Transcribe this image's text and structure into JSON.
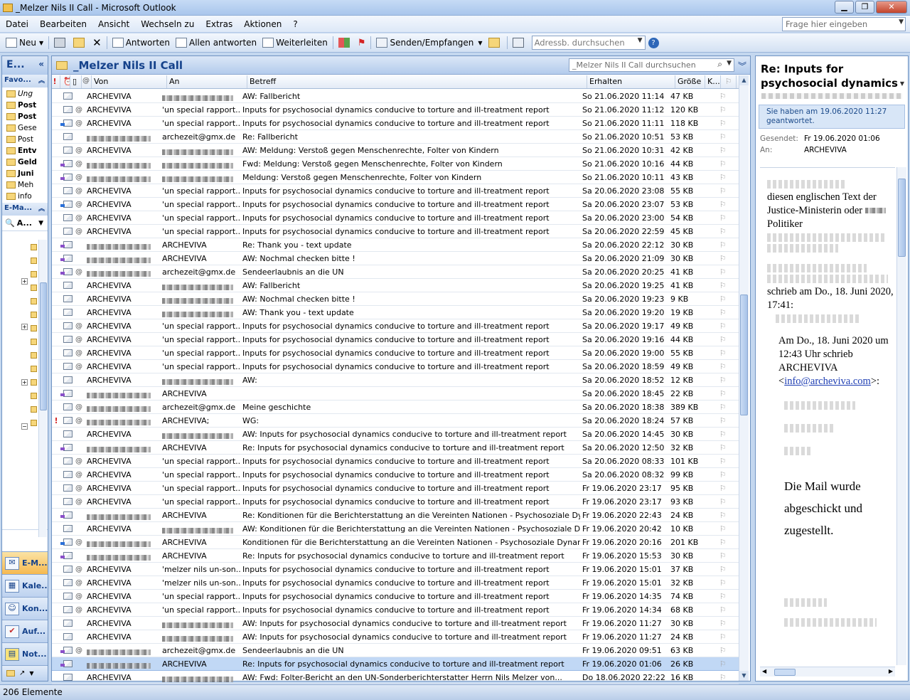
{
  "window": {
    "title": "_Melzer Nils II Call - Microsoft Outlook"
  },
  "menu": [
    "Datei",
    "Bearbeiten",
    "Ansicht",
    "Wechseln zu",
    "Extras",
    "Aktionen",
    "?"
  ],
  "help_placeholder": "Frage hier eingeben",
  "toolbar": {
    "new": "Neu",
    "reply": "Antworten",
    "reply_all": "Allen antworten",
    "forward": "Weiterleiten",
    "send_receive": "Senden/Empfangen",
    "address_search_placeholder": "Adressb. durchsuchen"
  },
  "nav": {
    "header": "E...",
    "favorites_title": "Favo...",
    "favorites": [
      "Ung",
      "Post",
      "Post",
      "Gese",
      "Post",
      "Entv",
      "Geld",
      "Juni",
      "Meh",
      "info"
    ],
    "mail_section": "E-Ma...",
    "all_label": "A...",
    "buttons": [
      "E-M...",
      "Kale...",
      "Kon...",
      "Auf...",
      "Not..."
    ]
  },
  "list": {
    "folder_title": "_Melzer Nils II Call",
    "search_placeholder": "_Melzer Nils II Call durchsuchen",
    "columns": {
      "von": "Von",
      "an": "An",
      "betreff": "Betreff",
      "erhalten": "Erhalten",
      "groesse": "Größe",
      "k": "K..."
    },
    "rows": [
      {
        "von": "ARCHEVIVA",
        "an": "",
        "betreff": "AW: Fallbericht",
        "erhalten": "So 21.06.2020 11:14",
        "groesse": "47 KB",
        "att": false,
        "icon": "read",
        "imp": false
      },
      {
        "von": "ARCHEVIVA",
        "an": "'un special rapport...",
        "betreff": "Inputs for psychosocial dynamics conducive to torture and ill-treatment report",
        "erhalten": "So 21.06.2020 11:12",
        "groesse": "120 KB",
        "att": true,
        "icon": "read",
        "imp": false
      },
      {
        "von": "ARCHEVIVA",
        "an": "'un special rapport...",
        "betreff": "Inputs for psychosocial dynamics conducive to torture and ill-treatment report",
        "erhalten": "So 21.06.2020 11:11",
        "groesse": "118 KB",
        "att": true,
        "icon": "fwd",
        "imp": false
      },
      {
        "von": "",
        "an": "archezeit@gmx.de",
        "betreff": "Re: Fallbericht",
        "erhalten": "So 21.06.2020 10:51",
        "groesse": "53 KB",
        "att": false,
        "icon": "read",
        "imp": false
      },
      {
        "von": "ARCHEVIVA",
        "an": "",
        "betreff": "AW: Meldung: Verstoß gegen Menschenrechte, Folter von Kindern",
        "erhalten": "So 21.06.2020 10:31",
        "groesse": "42 KB",
        "att": true,
        "icon": "read",
        "imp": false
      },
      {
        "von": "",
        "an": "",
        "betreff": "Fwd: Meldung: Verstoß gegen Menschenrechte, Folter von Kindern",
        "erhalten": "So 21.06.2020 10:16",
        "groesse": "44 KB",
        "att": true,
        "icon": "rep",
        "imp": false
      },
      {
        "von": "",
        "an": "",
        "betreff": "Meldung: Verstoß gegen Menschenrechte, Folter von Kindern",
        "erhalten": "So 21.06.2020 10:11",
        "groesse": "43 KB",
        "att": true,
        "icon": "rep",
        "imp": false
      },
      {
        "von": "ARCHEVIVA",
        "an": "'un special rapport...",
        "betreff": "Inputs for psychosocial dynamics conducive to torture and ill-treatment report",
        "erhalten": "Sa 20.06.2020 23:08",
        "groesse": "55 KB",
        "att": true,
        "icon": "read",
        "imp": false
      },
      {
        "von": "ARCHEVIVA",
        "an": "'un special rapport...",
        "betreff": "Inputs for psychosocial dynamics conducive to torture and ill-treatment report",
        "erhalten": "Sa 20.06.2020 23:07",
        "groesse": "53 KB",
        "att": true,
        "icon": "fwd",
        "imp": false
      },
      {
        "von": "ARCHEVIVA",
        "an": "'un special rapport...",
        "betreff": "Inputs for psychosocial dynamics conducive to torture and ill-treatment report",
        "erhalten": "Sa 20.06.2020 23:00",
        "groesse": "54 KB",
        "att": true,
        "icon": "read",
        "imp": false
      },
      {
        "von": "ARCHEVIVA",
        "an": "'un special rapport...",
        "betreff": "Inputs for psychosocial dynamics conducive to torture and ill-treatment report",
        "erhalten": "Sa 20.06.2020 22:59",
        "groesse": "45 KB",
        "att": true,
        "icon": "read",
        "imp": false
      },
      {
        "von": "",
        "an": "ARCHEVIVA",
        "betreff": "Re: Thank you - text update",
        "erhalten": "Sa 20.06.2020 22:12",
        "groesse": "30 KB",
        "att": false,
        "icon": "rep",
        "imp": false
      },
      {
        "von": "",
        "an": "ARCHEVIVA",
        "betreff": "AW: Nochmal checken bitte !",
        "erhalten": "Sa 20.06.2020 21:09",
        "groesse": "30 KB",
        "att": false,
        "icon": "rep",
        "imp": false
      },
      {
        "von": "",
        "an": "archezeit@gmx.de",
        "betreff": "Sendeerlaubnis an die UN",
        "erhalten": "Sa 20.06.2020 20:25",
        "groesse": "41 KB",
        "att": true,
        "icon": "rep",
        "imp": false
      },
      {
        "von": "ARCHEVIVA",
        "an": "",
        "betreff": "AW: Fallbericht",
        "erhalten": "Sa 20.06.2020 19:25",
        "groesse": "41 KB",
        "att": false,
        "icon": "read",
        "imp": false
      },
      {
        "von": "ARCHEVIVA",
        "an": "",
        "betreff": "AW: Nochmal checken bitte !",
        "erhalten": "Sa 20.06.2020 19:23",
        "groesse": "9 KB",
        "att": false,
        "icon": "read",
        "imp": false
      },
      {
        "von": "ARCHEVIVA",
        "an": "",
        "betreff": "AW: Thank you - text update",
        "erhalten": "Sa 20.06.2020 19:20",
        "groesse": "19 KB",
        "att": false,
        "icon": "read",
        "imp": false
      },
      {
        "von": "ARCHEVIVA",
        "an": "'un special rapport...",
        "betreff": "Inputs for psychosocial dynamics conducive to torture and ill-treatment report",
        "erhalten": "Sa 20.06.2020 19:17",
        "groesse": "49 KB",
        "att": true,
        "icon": "read",
        "imp": false
      },
      {
        "von": "ARCHEVIVA",
        "an": "'un special rapport...",
        "betreff": " Inputs for psychosocial dynamics conducive to torture and ill-treatment report",
        "erhalten": "Sa 20.06.2020 19:16",
        "groesse": "44 KB",
        "att": true,
        "icon": "read",
        "imp": false
      },
      {
        "von": "ARCHEVIVA",
        "an": "'un special rapport...",
        "betreff": "Inputs for psychosocial dynamics conducive to torture and ill-treatment report",
        "erhalten": "Sa 20.06.2020 19:00",
        "groesse": "55 KB",
        "att": true,
        "icon": "read",
        "imp": false
      },
      {
        "von": "ARCHEVIVA",
        "an": "'un special rapport...",
        "betreff": " Inputs for psychosocial dynamics conducive to torture and ill-treatment report",
        "erhalten": "Sa 20.06.2020 18:59",
        "groesse": "49 KB",
        "att": true,
        "icon": "read",
        "imp": false
      },
      {
        "von": "ARCHEVIVA",
        "an": "",
        "betreff": "AW:",
        "erhalten": "Sa 20.06.2020 18:52",
        "groesse": "12 KB",
        "att": false,
        "icon": "read",
        "imp": false
      },
      {
        "von": "",
        "an": "ARCHEVIVA",
        "betreff": "",
        "erhalten": "Sa 20.06.2020 18:45",
        "groesse": "22 KB",
        "att": false,
        "icon": "rep",
        "imp": false
      },
      {
        "von": "",
        "an": "archezeit@gmx.de",
        "betreff": "Meine geschichte",
        "erhalten": "Sa 20.06.2020 18:38",
        "groesse": "389 KB",
        "att": true,
        "icon": "read",
        "imp": false
      },
      {
        "von": "",
        "an": "ARCHEVIVA;",
        "betreff": "WG:",
        "erhalten": "Sa 20.06.2020 18:24",
        "groesse": "57 KB",
        "att": true,
        "icon": "read",
        "imp": true
      },
      {
        "von": "ARCHEVIVA",
        "an": "",
        "betreff": "AW: Inputs for psychosocial dynamics conducive to torture and ill-treatment report",
        "erhalten": "Sa 20.06.2020 14:45",
        "groesse": "30 KB",
        "att": false,
        "icon": "read",
        "imp": false
      },
      {
        "von": "",
        "an": "ARCHEVIVA",
        "betreff": "Re: Inputs for psychosocial dynamics conducive to torture and ill-treatment report",
        "erhalten": "Sa 20.06.2020 12:50",
        "groesse": "32 KB",
        "att": false,
        "icon": "rep",
        "imp": false
      },
      {
        "von": "ARCHEVIVA",
        "an": "'un special rapport...",
        "betreff": "Inputs for psychosocial dynamics conducive to torture and ill-treatment report",
        "erhalten": "Sa 20.06.2020 08:33",
        "groesse": "101 KB",
        "att": true,
        "icon": "read",
        "imp": false
      },
      {
        "von": "ARCHEVIVA",
        "an": "'un special rapport...",
        "betreff": "Inputs for psychosocial dynamics conducive to torture and ill-treatment report",
        "erhalten": "Sa 20.06.2020 08:32",
        "groesse": "99 KB",
        "att": true,
        "icon": "read",
        "imp": false
      },
      {
        "von": "ARCHEVIVA",
        "an": "'un special rapport...",
        "betreff": "Inputs for psychosocial dynamics conducive to torture and ill-treatment report",
        "erhalten": "Fr 19.06.2020 23:17",
        "groesse": "95 KB",
        "att": true,
        "icon": "read",
        "imp": false
      },
      {
        "von": "ARCHEVIVA",
        "an": "'un special rapport...",
        "betreff": "Inputs for psychosocial dynamics conducive to torture and ill-treatment report",
        "erhalten": "Fr 19.06.2020 23:17",
        "groesse": "93 KB",
        "att": true,
        "icon": "read",
        "imp": false
      },
      {
        "von": "",
        "an": "ARCHEVIVA",
        "betreff": "Re: Konditionen für die Berichterstattung an die Vereinten Nationen  - Psychosoziale Dyna...",
        "erhalten": "Fr 19.06.2020 22:43",
        "groesse": "24 KB",
        "att": false,
        "icon": "rep",
        "imp": false
      },
      {
        "von": "ARCHEVIVA",
        "an": "",
        "betreff": "AW: Konditionen für die Berichterstattung an die Vereinten Nationen  - Psychosoziale Dyn...",
        "erhalten": "Fr 19.06.2020 20:42",
        "groesse": "10 KB",
        "att": false,
        "icon": "read",
        "imp": false
      },
      {
        "von": "",
        "an": "ARCHEVIVA",
        "betreff": "Konditionen für die Berichterstattung an die Vereinten Nationen  - Psychosoziale Dynamik...",
        "erhalten": "Fr 19.06.2020 20:16",
        "groesse": "201 KB",
        "att": true,
        "icon": "fwd",
        "imp": false
      },
      {
        "von": "",
        "an": "ARCHEVIVA",
        "betreff": "Re: Inputs for psychosocial dynamics conducive to torture and ill-treatment report",
        "erhalten": "Fr 19.06.2020 15:53",
        "groesse": "30 KB",
        "att": false,
        "icon": "rep",
        "imp": false
      },
      {
        "von": "ARCHEVIVA",
        "an": "'melzer nils un-son...",
        "betreff": "Inputs for psychosocial dynamics conducive to torture and ill-treatment report",
        "erhalten": "Fr 19.06.2020 15:01",
        "groesse": "37 KB",
        "att": true,
        "icon": "read",
        "imp": false
      },
      {
        "von": "ARCHEVIVA",
        "an": "'melzer nils un-son...",
        "betreff": "Inputs for psychosocial dynamics conducive to torture and ill-treatment report",
        "erhalten": "Fr 19.06.2020 15:01",
        "groesse": "32 KB",
        "att": true,
        "icon": "read",
        "imp": false
      },
      {
        "von": "ARCHEVIVA",
        "an": "'un special rapport...",
        "betreff": "Inputs for psychosocial dynamics conducive to torture and ill-treatment report",
        "erhalten": "Fr 19.06.2020 14:35",
        "groesse": "74 KB",
        "att": true,
        "icon": "read",
        "imp": false
      },
      {
        "von": "ARCHEVIVA",
        "an": "'un special rapport...",
        "betreff": "Inputs for psychosocial dynamics conducive to torture and ill-treatment report",
        "erhalten": "Fr 19.06.2020 14:34",
        "groesse": "68 KB",
        "att": true,
        "icon": "read",
        "imp": false
      },
      {
        "von": "ARCHEVIVA",
        "an": "",
        "betreff": "AW: Inputs for psychosocial dynamics conducive to torture and ill-treatment report",
        "erhalten": "Fr 19.06.2020 11:27",
        "groesse": "30 KB",
        "att": false,
        "icon": "read",
        "imp": false
      },
      {
        "von": "ARCHEVIVA",
        "an": "",
        "betreff": "AW: Inputs for psychosocial dynamics conducive to torture and ill-treatment report",
        "erhalten": "Fr 19.06.2020 11:27",
        "groesse": "24 KB",
        "att": false,
        "icon": "read",
        "imp": false
      },
      {
        "von": "",
        "an": "archezeit@gmx.de",
        "betreff": "Sendeerlaubnis an die UN",
        "erhalten": "Fr 19.06.2020 09:51",
        "groesse": "63 KB",
        "att": true,
        "icon": "rep",
        "imp": false
      },
      {
        "von": "",
        "an": "ARCHEVIVA",
        "betreff": "Re: Inputs for psychosocial dynamics conducive to torture and ill-treatment report",
        "erhalten": "Fr 19.06.2020 01:06",
        "groesse": "26 KB",
        "att": false,
        "icon": "rep",
        "imp": false,
        "selected": true
      },
      {
        "von": "ARCHEVIVA",
        "an": "",
        "betreff": "AW: Fwd: Folter-Bericht an den UN-Sonderberichterstatter Herrn Nils Melzer von...",
        "erhalten": "Do 18.06.2020 22:22",
        "groesse": "16 KB",
        "att": false,
        "icon": "read",
        "imp": false
      }
    ]
  },
  "reading": {
    "subject": "Re: Inputs for psychosocial dynamics",
    "info": "Sie haben am 19.06.2020 11:27 geantwortet.",
    "sent_label": "Gesendet:",
    "sent_value": "Fr 19.06.2020 01:06",
    "to_label": "An:",
    "to_value": "ARCHEVIVA",
    "body_1": "diesen englischen Text der Justice-Ministerin oder",
    "body_1b": "Politiker",
    "body_2": "schrieb am Do., 18. Juni 2020, 17:41:",
    "body_3": "Am Do., 18. Juni 2020 um 12:43 Uhr schrieb ARCHEVIVA <",
    "body_link": "info@archeviva.com",
    "body_3b": ">:",
    "body_4": "Die Mail wurde abgeschickt und zugestellt."
  },
  "status": {
    "count": "206 Elemente"
  }
}
